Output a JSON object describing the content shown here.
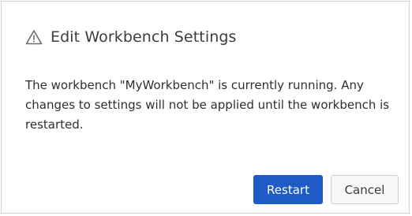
{
  "dialog": {
    "title": "Edit Workbench Settings",
    "title_icon": "warning-triangle-icon",
    "message": "The workbench \"MyWorkbench\" is currently running. Any changes to settings will not be applied until the workbench is restarted.",
    "buttons": {
      "restart_label": "Restart",
      "cancel_label": "Cancel"
    }
  },
  "colors": {
    "primary_button": "#1f5bc6",
    "text": "#3c3c3c",
    "border": "#d0d0d0"
  }
}
